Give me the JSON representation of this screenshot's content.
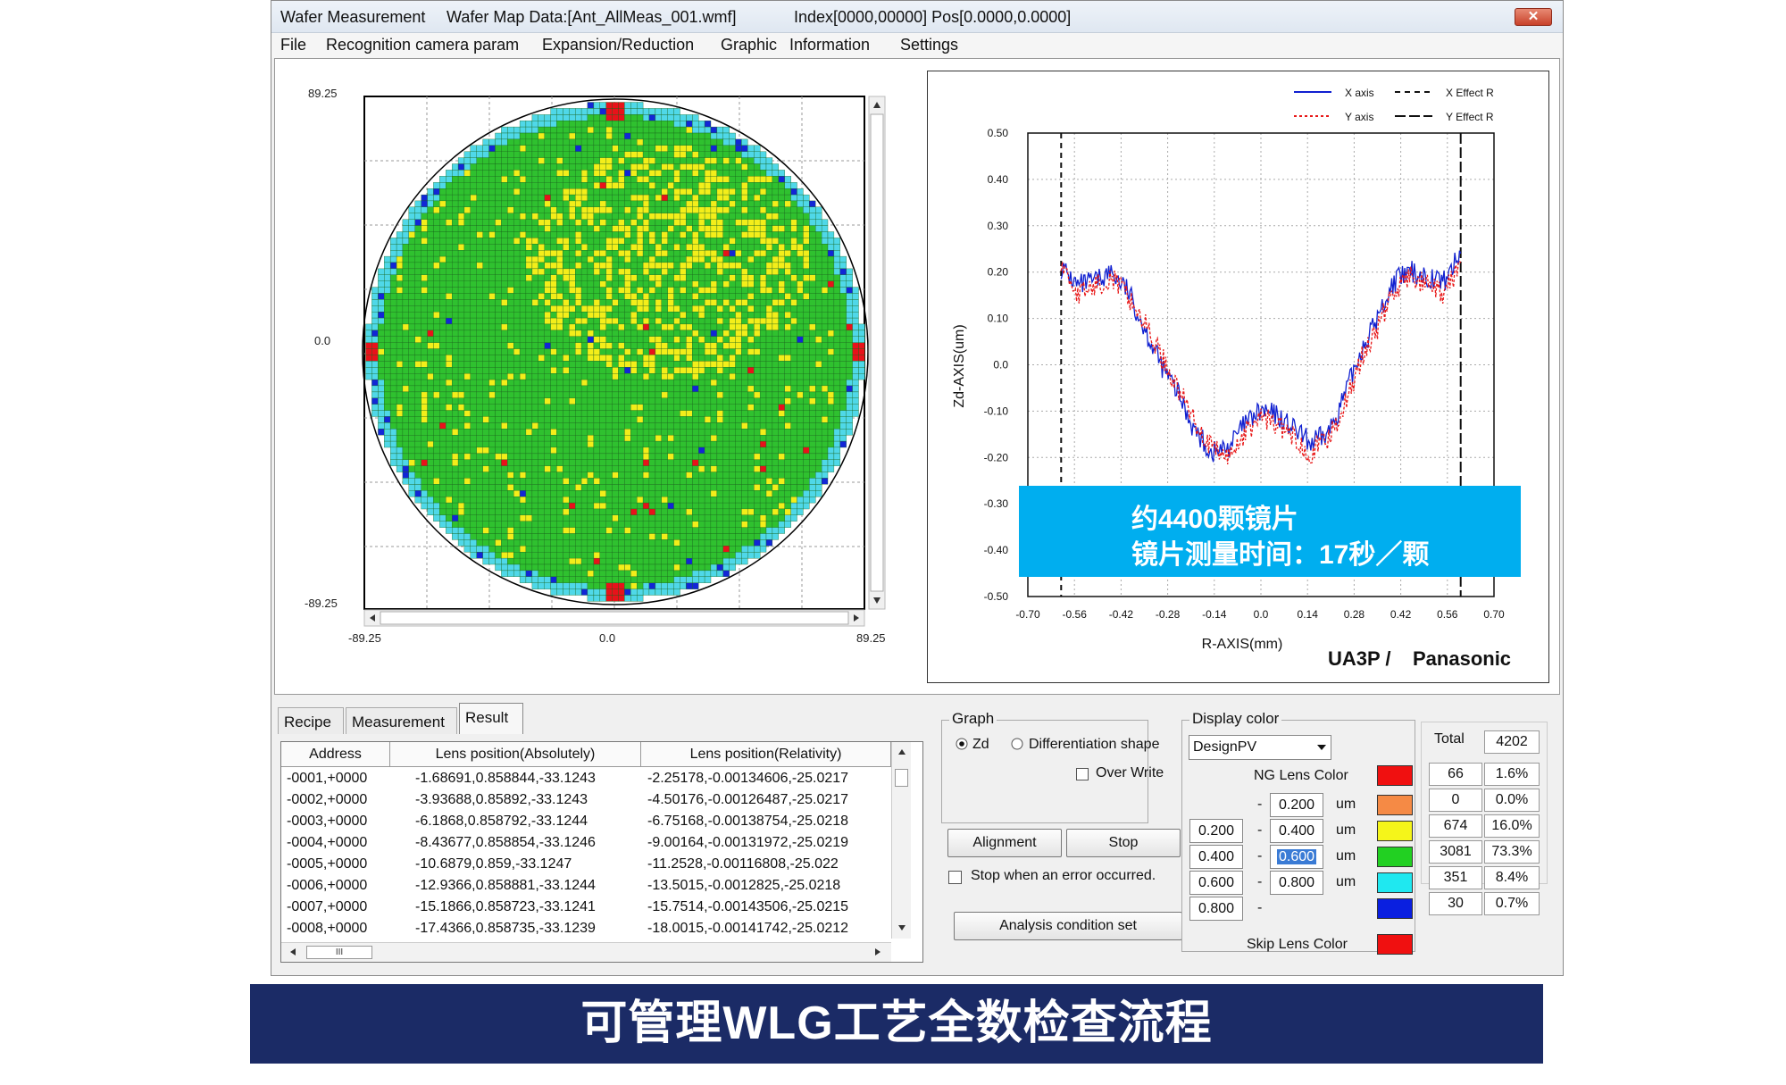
{
  "window": {
    "title": "Wafer Measurement",
    "map_data": "Wafer Map Data:[Ant_AllMeas_001.wmf]",
    "index_pos": "Index[0000,00000] Pos[0.0000,0.0000]",
    "close_symbol": "✕"
  },
  "menu": [
    "File",
    "Recognition camera param",
    "Expansion/Reduction",
    "Graphic",
    "Information",
    "Settings"
  ],
  "wafer_map": {
    "y_top": "89.25",
    "y_mid": "0.0",
    "y_bottom": "-89.25",
    "x_left": "-89.25",
    "x_mid": "0.0",
    "x_right": "89.25",
    "colors": {
      "good": "#2fc12f",
      "edge": "#4fd8e8",
      "warn": "#f3ee1a",
      "ng": "#e8121a",
      "blue": "#1226d6",
      "grid": "#17641a"
    }
  },
  "chart_data": {
    "type": "line",
    "xlabel": "R-AXIS(mm)",
    "ylabel": "Zd-AXIS(um)",
    "xlim": [
      -0.7,
      0.7
    ],
    "ylim": [
      -0.5,
      0.5
    ],
    "x_ticks": [
      "-0.70",
      "-0.56",
      "-0.42",
      "-0.28",
      "-0.14",
      "0.0",
      "0.14",
      "0.28",
      "0.42",
      "0.56",
      "0.70"
    ],
    "y_ticks": [
      "0.50",
      "0.40",
      "0.30",
      "0.20",
      "0.10",
      "0.0",
      "-0.10",
      "-0.20",
      "-0.30",
      "-0.40",
      "-0.50"
    ],
    "effect_r": [
      -0.6,
      0.6
    ],
    "legend": {
      "x_axis": "X axis",
      "y_axis": "Y axis",
      "x_effect": "X Effect R",
      "y_effect": "Y Effect R"
    },
    "series": [
      {
        "name": "X axis",
        "color": "#1020d0",
        "x": [
          -0.6,
          -0.55,
          -0.5,
          -0.45,
          -0.4,
          -0.35,
          -0.3,
          -0.25,
          -0.2,
          -0.15,
          -0.1,
          -0.05,
          0.0,
          0.05,
          0.1,
          0.15,
          0.2,
          0.25,
          0.3,
          0.35,
          0.4,
          0.45,
          0.5,
          0.55,
          0.6
        ],
        "values": [
          0.21,
          0.17,
          0.18,
          0.2,
          0.16,
          0.08,
          0.0,
          -0.06,
          -0.14,
          -0.19,
          -0.18,
          -0.13,
          -0.1,
          -0.11,
          -0.14,
          -0.17,
          -0.15,
          -0.07,
          0.03,
          0.1,
          0.18,
          0.2,
          0.19,
          0.18,
          0.24
        ]
      },
      {
        "name": "Y axis",
        "color": "#e81818",
        "x": [
          -0.6,
          -0.55,
          -0.5,
          -0.45,
          -0.4,
          -0.35,
          -0.3,
          -0.25,
          -0.2,
          -0.15,
          -0.1,
          -0.05,
          0.0,
          0.05,
          0.1,
          0.15,
          0.2,
          0.25,
          0.3,
          0.35,
          0.4,
          0.45,
          0.5,
          0.55,
          0.6
        ],
        "values": [
          0.22,
          0.15,
          0.17,
          0.19,
          0.15,
          0.09,
          0.02,
          -0.05,
          -0.12,
          -0.18,
          -0.2,
          -0.15,
          -0.11,
          -0.13,
          -0.16,
          -0.19,
          -0.16,
          -0.09,
          0.01,
          0.08,
          0.16,
          0.19,
          0.17,
          0.15,
          0.22
        ]
      }
    ]
  },
  "brand": {
    "ua3p": "UA3P /",
    "maker": "Panasonic"
  },
  "callout": {
    "line1": "约4400颗镜片",
    "line2": "镜片测量时间：17秒／颗"
  },
  "tabs": [
    "Recipe",
    "Measurement",
    "Result"
  ],
  "result_table": {
    "headers": [
      "Address",
      "Lens position(Absolutely)",
      "Lens position(Relativity)"
    ],
    "rows": [
      [
        "-0001,+0000",
        "-1.68691,0.858844,-33.1243",
        "-2.25178,-0.00134606,-25.0217"
      ],
      [
        "-0002,+0000",
        "-3.93688,0.85892,-33.1243",
        "-4.50176,-0.00126487,-25.0217"
      ],
      [
        "-0003,+0000",
        "-6.1868,0.858792,-33.1244",
        "-6.75168,-0.00138754,-25.0218"
      ],
      [
        "-0004,+0000",
        "-8.43677,0.858854,-33.1246",
        "-9.00164,-0.00131972,-25.0219"
      ],
      [
        "-0005,+0000",
        "-10.6879,0.859,-33.1247",
        "-11.2528,-0.00116808,-25.022"
      ],
      [
        "-0006,+0000",
        "-12.9366,0.858881,-33.1244",
        "-13.5015,-0.0012825,-25.0218"
      ],
      [
        "-0007,+0000",
        "-15.1866,0.858723,-33.1241",
        "-15.7514,-0.00143506,-25.0215"
      ],
      [
        "-0008,+0000",
        "-17.4366,0.858735,-33.1239",
        "-18.0015,-0.00141742,-25.0212"
      ]
    ],
    "scroll_grip": "III"
  },
  "graph_group": {
    "label": "Graph",
    "zd": "Zd",
    "diff": "Differentiation shape",
    "overwrite": "Over Write",
    "alignment": "Alignment",
    "stop": "Stop",
    "stop_on_error": "Stop when an error occurred.",
    "analysis": "Analysis condition set"
  },
  "display_color": {
    "label": "Display  color",
    "select_value": "DesignPV",
    "ng_label": "NG Lens Color",
    "skip_label": "Skip Lens Color",
    "unit": "um",
    "rows": [
      {
        "left": "",
        "dash": "-",
        "right": "0.200",
        "unit": "um",
        "color": "#f58a45"
      },
      {
        "left": "0.200",
        "dash": "-",
        "right": "0.400",
        "unit": "um",
        "color": "#f5f51a"
      },
      {
        "left": "0.400",
        "dash": "-",
        "right": "0.600",
        "unit": "um",
        "color": "#22d022"
      },
      {
        "left": "0.600",
        "dash": "-",
        "right": "0.800",
        "unit": "um",
        "color": "#1fe8f0"
      },
      {
        "left": "0.800",
        "dash": "-",
        "right": "",
        "unit": "",
        "color": "#0a1fe0"
      }
    ],
    "ng_color": "#f01010",
    "skip_color": "#f01010"
  },
  "stats": {
    "total_label": "Total",
    "total_value": "4202",
    "rows": [
      {
        "count": "66",
        "pct": "1.6%"
      },
      {
        "count": "0",
        "pct": "0.0%"
      },
      {
        "count": "674",
        "pct": "16.0%"
      },
      {
        "count": "3081",
        "pct": "73.3%"
      },
      {
        "count": "351",
        "pct": "8.4%"
      },
      {
        "count": "30",
        "pct": "0.7%"
      }
    ]
  },
  "banner": {
    "text": "可管理WLG工艺全数检查流程"
  }
}
